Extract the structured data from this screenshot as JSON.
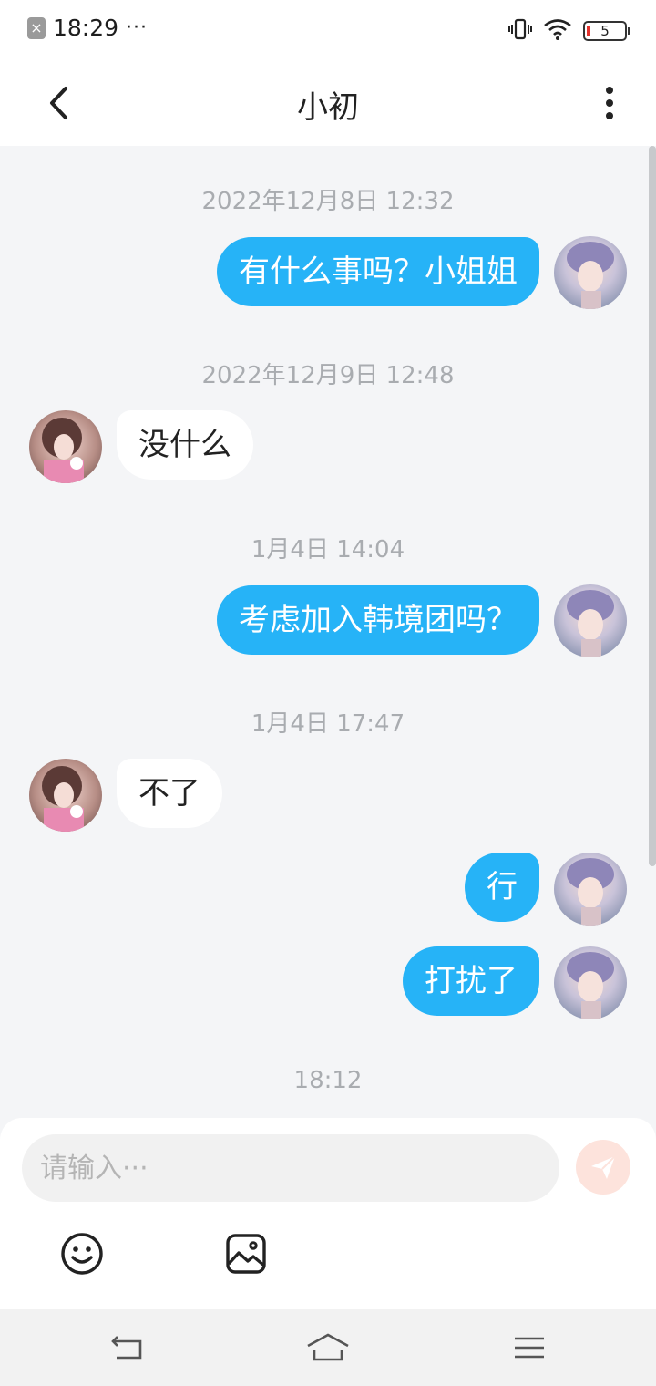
{
  "status_bar": {
    "time": "18:29",
    "more": "···",
    "battery": "5"
  },
  "header": {
    "title": "小初"
  },
  "messages": [
    {
      "timestamp": "2022年12月8日 12:32"
    },
    {
      "sender": "me",
      "text": "有什么事吗？小姐姐"
    },
    {
      "timestamp": "2022年12月9日 12:48"
    },
    {
      "sender": "other",
      "text": "没什么"
    },
    {
      "timestamp": "1月4日 14:04"
    },
    {
      "sender": "me",
      "text": "考虑加入韩境团吗？"
    },
    {
      "timestamp": "1月4日 17:47"
    },
    {
      "sender": "other",
      "text": "不了"
    },
    {
      "sender": "me",
      "text": "行"
    },
    {
      "sender": "me",
      "text": "打扰了"
    },
    {
      "timestamp": "18:12"
    }
  ],
  "input": {
    "placeholder": "请输入···"
  },
  "icons": {
    "back": "back-arrow-icon",
    "more": "more-vertical-icon",
    "send": "send-icon",
    "emoji": "emoji-icon",
    "image": "image-icon"
  },
  "colors": {
    "my_bubble": "#26b3f7",
    "other_bubble": "#ffffff",
    "send_button": "#fde3dc"
  }
}
